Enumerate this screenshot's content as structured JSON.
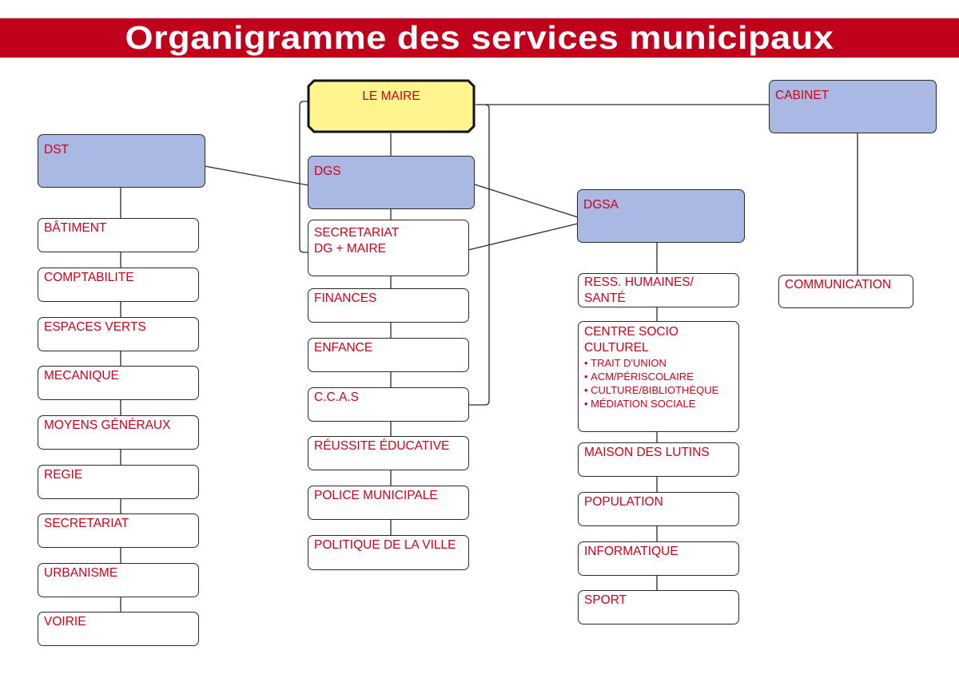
{
  "title": "Organigramme des services municipaux",
  "colors": {
    "banner": "#c1001b",
    "text": "#cc0019",
    "director_fill": "#aab9e3",
    "mayor_fill": "#fff48e",
    "line": "#2a2a2a"
  },
  "mayor": {
    "label": "LE MAIRE"
  },
  "cabinet": {
    "label": "CABINET",
    "children": [
      "COMMUNICATION"
    ]
  },
  "dst": {
    "label": "DST",
    "children": [
      "BÂTIMENT",
      "COMPTABILITE",
      "ESPACES VERTS",
      "MECANIQUE",
      "MOYENS GÉNÉRAUX",
      "REGIE",
      "SECRETARIAT",
      "URBANISME",
      "VOIRIE"
    ]
  },
  "dgs": {
    "label": "DGS",
    "secretariat": {
      "line1": "SECRETARIAT",
      "line2": "DG + MAIRE"
    },
    "children": [
      "FINANCES",
      "ENFANCE",
      "C.C.A.S",
      "RÉUSSITE ÉDUCATIVE",
      "POLICE MUNICIPALE",
      "POLITIQUE DE LA VILLE"
    ]
  },
  "dgsa": {
    "label": "DGSA",
    "rh": {
      "line1": "RESS. HUMAINES/",
      "line2": "SANTÉ"
    },
    "centre": {
      "line1": "CENTRE SOCIO",
      "line2": "CULTUREL",
      "items": [
        "TRAIT  D'UNION",
        "ACM/PÉRISCOLAIRE",
        "CULTURE/BIBLIOTHÈQUE",
        "MÉDIATION SOCIALE"
      ]
    },
    "children": [
      "MAISON DES LUTINS",
      "POPULATION",
      "INFORMATIQUE",
      "SPORT"
    ]
  }
}
